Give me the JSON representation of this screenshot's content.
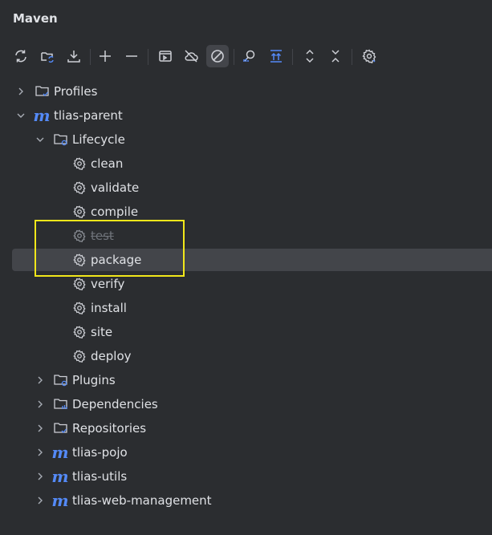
{
  "panel": {
    "title": "Maven"
  },
  "toolbar": {
    "icons": [
      "reload-icon",
      "reload-all-icon",
      "download-icon",
      "add-icon",
      "remove-icon",
      "run-config-icon",
      "offline-icon",
      "skip-tests-icon",
      "analyze-icon",
      "show-deps-icon",
      "expand-all-icon",
      "collapse-all-icon",
      "settings-icon"
    ],
    "active": "skip-tests-icon"
  },
  "tree": {
    "profiles": "Profiles",
    "root": "tlias-parent",
    "lifecycle": "Lifecycle",
    "phases": [
      "clean",
      "validate",
      "compile",
      "test",
      "package",
      "verify",
      "install",
      "site",
      "deploy"
    ],
    "disabled_phase": "test",
    "selected_phase": "package",
    "plugins": "Plugins",
    "dependencies": "Dependencies",
    "repositories": "Repositories",
    "modules": [
      "tlias-pojo",
      "tlias-utils",
      "tlias-web-management"
    ]
  },
  "colors": {
    "background": "#2b2d30",
    "selection": "#43454a",
    "maven_blue": "#548af7",
    "highlight_box": "#f2e71a",
    "disabled_text": "#6f737a"
  }
}
